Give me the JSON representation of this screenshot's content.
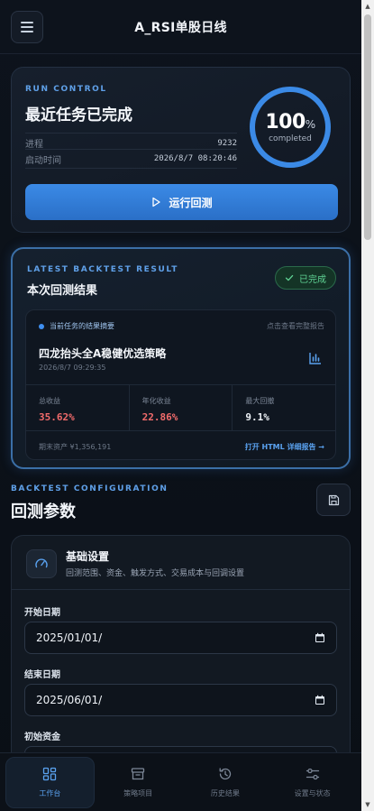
{
  "header": {
    "title": "A_RSI单股日线",
    "menu_icon": "hamburger-menu-icon"
  },
  "run_control": {
    "eyebrow": "RUN CONTROL",
    "title": "最近任务已完成",
    "progress_label": "进程",
    "progress_value": "9232",
    "start_label": "启动时间",
    "start_value": "2026/8/7 08:20:46",
    "ring_percent": "100",
    "ring_percent_unit": "%",
    "ring_fraction": 1.0,
    "ring_sub": "completed",
    "run_button": "运行回测"
  },
  "latest_result": {
    "eyebrow": "LATEST BACKTEST RESULT",
    "title": "本次回测结果",
    "badge": "已完成",
    "summary_label": "当前任务的结果摘要",
    "summary_link": "点击查看完整报告",
    "strategy_name": "四龙抬头全A稳健优选策略",
    "strategy_time": "2026/8/7 09:29:35",
    "metrics": [
      {
        "label": "总收益",
        "value": "35.62%"
      },
      {
        "label": "年化收益",
        "value": "22.86%"
      },
      {
        "label": "最大回撤",
        "value": "9.1%"
      }
    ],
    "final_asset": "期末资产 ¥1,356,191",
    "open_report": "打开 HTML 详细报告 →"
  },
  "config": {
    "eyebrow": "BACKTEST CONFIGURATION",
    "title": "回测参数",
    "basic_title": "基础设置",
    "basic_desc": "回测范围、资金、触发方式、交易成本与回调设置",
    "start_date_label": "开始日期",
    "start_date_value": "2025/01/01/",
    "end_date_label": "结束日期",
    "end_date_value": "2025/06/01/",
    "capital_label": "初始资金"
  },
  "nav": [
    {
      "label": "工作台",
      "icon": "dashboard-grid-icon",
      "active": true
    },
    {
      "label": "策略项目",
      "icon": "archive-box-icon",
      "active": false
    },
    {
      "label": "历史结果",
      "icon": "history-clock-icon",
      "active": false
    },
    {
      "label": "设置与状态",
      "icon": "sliders-icon",
      "active": false
    }
  ],
  "colors": {
    "accent": "#3b8ae6",
    "positive": "#f26b6b",
    "success": "#5fd394",
    "background": "#0b1018"
  }
}
